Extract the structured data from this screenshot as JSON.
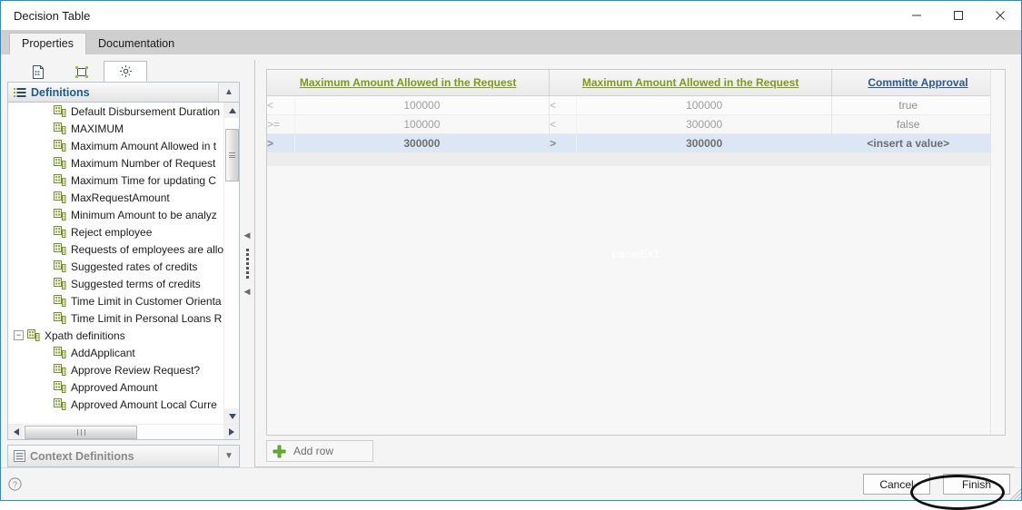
{
  "window": {
    "title": "Decision Table",
    "controls": {
      "minimize": "minimize-icon",
      "maximize": "maximize-icon",
      "close": "close-icon"
    }
  },
  "tabs": [
    {
      "label": "Properties",
      "active": true
    },
    {
      "label": "Documentation",
      "active": false
    }
  ],
  "left_panel": {
    "mini_tabs": [
      {
        "name": "document-tab",
        "icon": "document-icon",
        "active": false
      },
      {
        "name": "diagram-tab",
        "icon": "diagram-icon",
        "active": false
      },
      {
        "name": "settings-tab",
        "icon": "gear-icon",
        "active": true
      }
    ],
    "definitions_section": {
      "title": "Definitions",
      "icon": "list-icon",
      "chevron": "chevron-up-icon",
      "items": [
        {
          "label": "Default Disbursement Duration",
          "indent": 2,
          "icon": "definition-icon"
        },
        {
          "label": "MAXIMUM",
          "indent": 2,
          "icon": "definition-icon"
        },
        {
          "label": "Maximum Amount Allowed in t",
          "indent": 2,
          "icon": "definition-icon"
        },
        {
          "label": "Maximum Number of Request",
          "indent": 2,
          "icon": "definition-icon"
        },
        {
          "label": "Maximum Time for updating C",
          "indent": 2,
          "icon": "definition-icon"
        },
        {
          "label": "MaxRequestAmount",
          "indent": 2,
          "icon": "definition-icon"
        },
        {
          "label": "Minimum Amount to be analyz",
          "indent": 2,
          "icon": "definition-icon"
        },
        {
          "label": "Reject employee",
          "indent": 2,
          "icon": "definition-icon"
        },
        {
          "label": "Requests of employees are allo",
          "indent": 2,
          "icon": "definition-icon"
        },
        {
          "label": "Suggested rates of credits",
          "indent": 2,
          "icon": "definition-icon"
        },
        {
          "label": "Suggested terms of credits",
          "indent": 2,
          "icon": "definition-icon"
        },
        {
          "label": "Time Limit in Customer Orienta",
          "indent": 2,
          "icon": "definition-icon"
        },
        {
          "label": "Time Limit in Personal Loans R",
          "indent": 2,
          "icon": "definition-icon"
        },
        {
          "label": "Xpath definitions",
          "indent": 0,
          "icon": "definition-icon",
          "expander": "−"
        },
        {
          "label": "AddApplicant",
          "indent": 2,
          "icon": "definition-icon"
        },
        {
          "label": "Approve Review Request?",
          "indent": 2,
          "icon": "definition-icon"
        },
        {
          "label": "Approved Amount",
          "indent": 2,
          "icon": "definition-icon"
        },
        {
          "label": "Approved Amount Local Curre",
          "indent": 2,
          "icon": "definition-icon"
        }
      ]
    },
    "context_section": {
      "title": "Context Definitions",
      "icon": "list-icon",
      "chevron": "chevron-down-icon"
    }
  },
  "splitter": {
    "collapse_up": "collapse-left-arrow",
    "collapse_down": "collapse-left-arrow-2"
  },
  "grid": {
    "watermark": "panelEx1",
    "columns": [
      {
        "label": "Maximum Amount Allowed in the Request",
        "color": "#7d9b16"
      },
      {
        "label": "Maximum Amount Allowed in the Request",
        "color": "#7d9b16"
      },
      {
        "label": "Committe Approval",
        "color": "#2b5797"
      }
    ],
    "rows": [
      {
        "op1": "<",
        "val1": "100000",
        "op2": "<",
        "val2": "100000",
        "result": "true",
        "delete": "delete-icon",
        "selected": false
      },
      {
        "op1": ">=",
        "val1": "100000",
        "op2": "<",
        "val2": "300000",
        "result": "false",
        "delete": "delete-icon",
        "selected": false
      },
      {
        "op1": ">",
        "val1": "300000",
        "op2": ">",
        "val2": "300000",
        "result": "<insert a value>",
        "delete": "delete-icon",
        "selected": true
      }
    ],
    "add_row": {
      "label": "Add row",
      "icon": "plus-icon"
    }
  },
  "footer": {
    "help": "help-icon",
    "cancel_label": "Cancel",
    "finish_label": "Finish"
  }
}
